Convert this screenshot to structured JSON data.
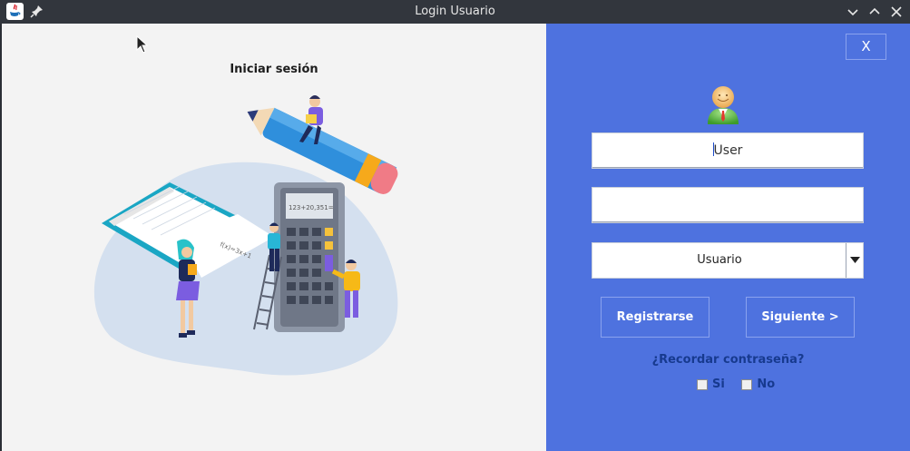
{
  "window": {
    "title": "Login Usuario",
    "icons": {
      "app": "java-icon",
      "pin": "pin-icon",
      "minimize": "chevron-down-icon",
      "maximize": "chevron-up-icon",
      "close": "close-icon"
    }
  },
  "left_panel": {
    "heading": "Iniciar sesión",
    "illustration": "study-illustration"
  },
  "right_panel": {
    "close_label": "X",
    "user_field": {
      "value": "User"
    },
    "password_field": {
      "value": ""
    },
    "role_select": {
      "selected": "Usuario"
    },
    "register_label": "Registrarse",
    "next_label": "Siguiente >",
    "remember_label": "¿Recordar contraseña?",
    "options": [
      {
        "label": "Si",
        "checked": false
      },
      {
        "label": "No",
        "checked": false
      }
    ]
  },
  "colors": {
    "accent": "#4e72df",
    "left_bg": "#f3f3f3",
    "titlebar": "#32363d",
    "text_dark_blue": "#173a8f"
  }
}
